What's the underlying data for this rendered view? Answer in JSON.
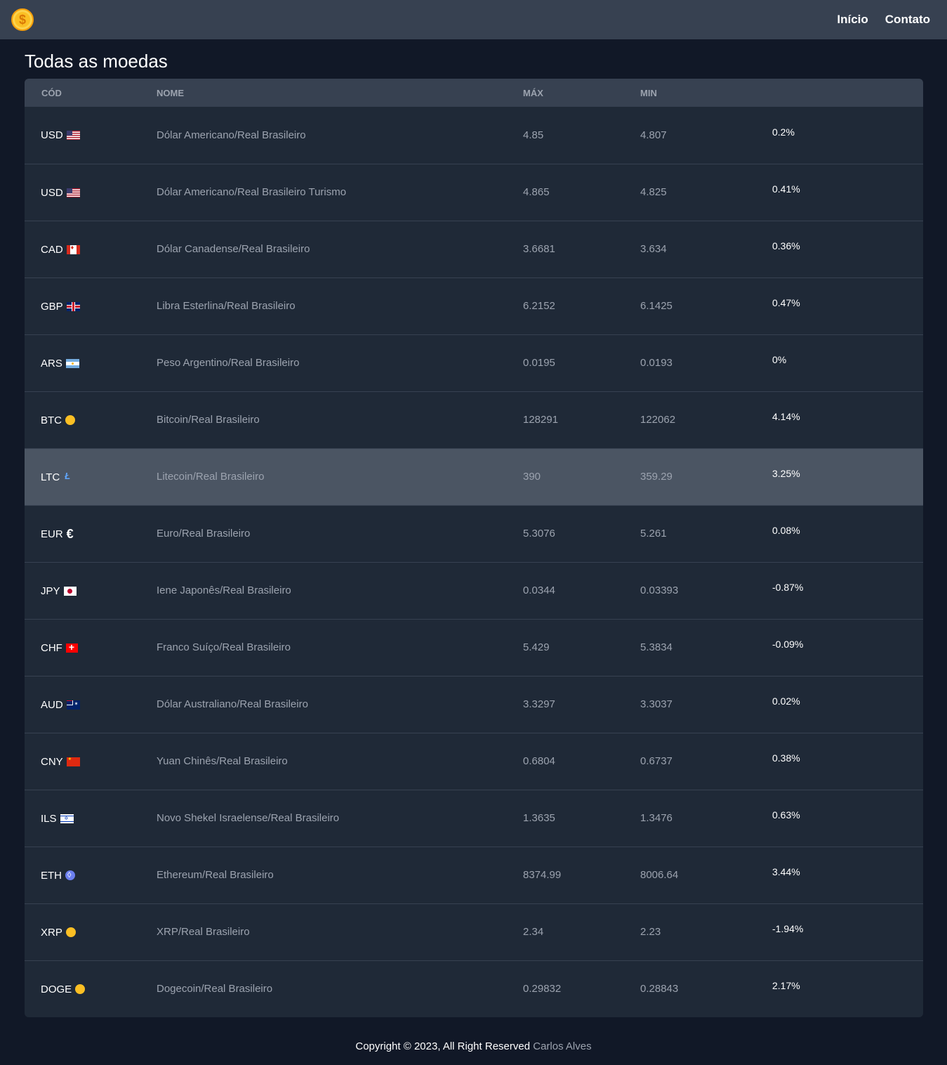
{
  "nav": {
    "logo_icon": "dollar-coin-icon",
    "links": [
      "Início",
      "Contato"
    ]
  },
  "page": {
    "title": "Todas as moedas"
  },
  "table": {
    "headers": [
      "CÓD",
      "NOME",
      "MÁX",
      "MIN",
      ""
    ],
    "rows": [
      {
        "code": "USD",
        "icon": "us-flag-icon",
        "name": "Dólar Americano/Real Brasileiro",
        "max": "4.85",
        "min": "4.807",
        "pct": "0.2%"
      },
      {
        "code": "USD",
        "icon": "us-flag-icon",
        "name": "Dólar Americano/Real Brasileiro Turismo",
        "max": "4.865",
        "min": "4.825",
        "pct": "0.41%"
      },
      {
        "code": "CAD",
        "icon": "canada-flag-icon",
        "name": "Dólar Canadense/Real Brasileiro",
        "max": "3.6681",
        "min": "3.634",
        "pct": "0.36%"
      },
      {
        "code": "GBP",
        "icon": "uk-flag-icon",
        "name": "Libra Esterlina/Real Brasileiro",
        "max": "6.2152",
        "min": "6.1425",
        "pct": "0.47%"
      },
      {
        "code": "ARS",
        "icon": "argentina-flag-icon",
        "name": "Peso Argentino/Real Brasileiro",
        "max": "0.0195",
        "min": "0.0193",
        "pct": "0%"
      },
      {
        "code": "BTC",
        "icon": "coin-icon",
        "name": "Bitcoin/Real Brasileiro",
        "max": "128291",
        "min": "122062",
        "pct": "4.14%"
      },
      {
        "code": "LTC",
        "icon": "litecoin-icon",
        "name": "Litecoin/Real Brasileiro",
        "max": "390",
        "min": "359.29",
        "pct": "3.25%"
      },
      {
        "code": "EUR",
        "icon": "euro-icon",
        "name": "Euro/Real Brasileiro",
        "max": "5.3076",
        "min": "5.261",
        "pct": "0.08%"
      },
      {
        "code": "JPY",
        "icon": "japan-flag-icon",
        "name": "Iene Japonês/Real Brasileiro",
        "max": "0.0344",
        "min": "0.03393",
        "pct": "-0.87%"
      },
      {
        "code": "CHF",
        "icon": "switzerland-flag-icon",
        "name": "Franco Suíço/Real Brasileiro",
        "max": "5.429",
        "min": "5.3834",
        "pct": "-0.09%"
      },
      {
        "code": "AUD",
        "icon": "australia-flag-icon",
        "name": "Dólar Australiano/Real Brasileiro",
        "max": "3.3297",
        "min": "3.3037",
        "pct": "0.02%"
      },
      {
        "code": "CNY",
        "icon": "china-flag-icon",
        "name": "Yuan Chinês/Real Brasileiro",
        "max": "0.6804",
        "min": "0.6737",
        "pct": "0.38%"
      },
      {
        "code": "ILS",
        "icon": "israel-flag-icon",
        "name": "Novo Shekel Israelense/Real Brasileiro",
        "max": "1.3635",
        "min": "1.3476",
        "pct": "0.63%"
      },
      {
        "code": "ETH",
        "icon": "ethereum-icon",
        "name": "Ethereum/Real Brasileiro",
        "max": "8374.99",
        "min": "8006.64",
        "pct": "3.44%"
      },
      {
        "code": "XRP",
        "icon": "coin-icon",
        "name": "XRP/Real Brasileiro",
        "max": "2.34",
        "min": "2.23",
        "pct": "-1.94%"
      },
      {
        "code": "DOGE",
        "icon": "coin-icon",
        "name": "Dogecoin/Real Brasileiro",
        "max": "0.29832",
        "min": "0.28843",
        "pct": "2.17%"
      }
    ]
  },
  "footer": {
    "text": "Copyright © 2023, All Right Reserved",
    "author": "Carlos Alves"
  },
  "colors": {
    "background": "#111827",
    "navbar": "#374151",
    "card": "#1f2937",
    "row_hover": "#4b5563",
    "muted_text": "#9ca3af"
  }
}
